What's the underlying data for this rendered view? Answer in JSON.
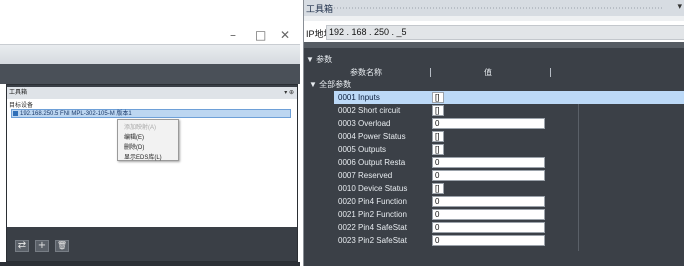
{
  "left_window": {
    "controls": {
      "minimize": "–",
      "maximize": "□",
      "close": "✕"
    },
    "toolbox": {
      "title": "工具箱",
      "title_ctrl": "▾ ⊕",
      "tree_root": "目标设备",
      "tree_node": "192.168.250.5   FNI MPL-302-105-M   版本1",
      "context_menu": [
        {
          "label": "添加映射(A)",
          "disabled": true
        },
        {
          "label": "编辑(E)",
          "disabled": false
        },
        {
          "label": "删除(D)",
          "disabled": false
        },
        {
          "label": "显示EDS库(L)",
          "disabled": false
        }
      ],
      "bottom_buttons": [
        {
          "icon": "connect-icon",
          "glyph": "⇄"
        },
        {
          "icon": "add-icon",
          "glyph": "+"
        },
        {
          "icon": "delete-icon",
          "glyph": "🗑"
        }
      ]
    }
  },
  "right_window": {
    "title": "工具箱",
    "title_ctrl": "▾",
    "ip_label": "IP地址",
    "ip_value": "192 . 168 . 250 .  _5",
    "section_header": "▼ 参数",
    "columns": {
      "name": "参数名称",
      "value": "值"
    },
    "all_params_label": "▼  全部参数",
    "params": [
      {
        "name": "0001 Inputs",
        "value": "[]",
        "short": true,
        "selected": true
      },
      {
        "name": "0002 Short circuit",
        "value": "[]",
        "short": true,
        "selected": false
      },
      {
        "name": "0003 Overload",
        "value": "0",
        "short": false,
        "selected": false
      },
      {
        "name": "0004 Power Status",
        "value": "[]",
        "short": true,
        "selected": false
      },
      {
        "name": "0005 Outputs",
        "value": "[]",
        "short": true,
        "selected": false
      },
      {
        "name": "0006 Output Resta",
        "value": "0",
        "short": false,
        "selected": false
      },
      {
        "name": "0007 Reserved",
        "value": "0",
        "short": false,
        "selected": false
      },
      {
        "name": "0010 Device Status",
        "value": "[]",
        "short": true,
        "selected": false
      },
      {
        "name": "0020 Pin4 Function",
        "value": "0",
        "short": false,
        "selected": false
      },
      {
        "name": "0021 Pin2 Function",
        "value": "0",
        "short": false,
        "selected": false
      },
      {
        "name": "0022 Pin4 SafeStat",
        "value": "0",
        "short": false,
        "selected": false
      },
      {
        "name": "0023 Pin2 SafeStat",
        "value": "0",
        "short": false,
        "selected": false
      }
    ]
  },
  "colors": {
    "selection": "#bcd9f7",
    "panel_dark": "#3b4047",
    "title_bar": "#d7dce2"
  }
}
